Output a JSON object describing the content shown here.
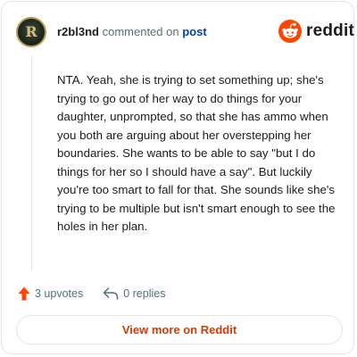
{
  "header": {
    "username": "r2bl3nd",
    "commented_text": "commented on",
    "post_link": "post",
    "avatar_letter": "R"
  },
  "brand": {
    "wordmark": "reddit",
    "icon": "reddit-snoo-icon",
    "accent_color": "#FF4500"
  },
  "comment": {
    "body": "NTA. Yeah, she is trying to set something up; she's trying to go out of her way to do things for your daughter, unprompted, so that she has ammo when you both are arguing about her overstepping her boundaries. She wants to be able to say \"but I do things for her so I should have a say\". But luckily you're too smart to fall for that. She sounds like she's trying to be multiple but isn't smart enough to see the holes in her plan."
  },
  "actions": {
    "upvotes_label": "3 upvotes",
    "upvote_icon": "upvote-arrow-icon",
    "upvote_color": "#FF4500",
    "replies_label": "0 replies",
    "reply_icon": "reply-arrow-icon"
  },
  "footer": {
    "view_more_label": "View more on Reddit",
    "view_more_color": "#D93A00"
  }
}
